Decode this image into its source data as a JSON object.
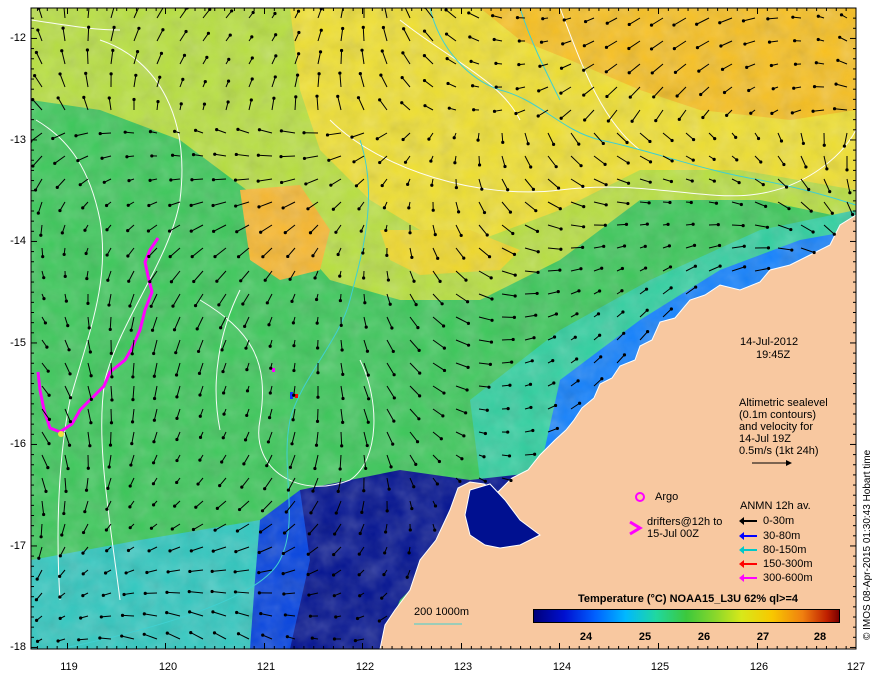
{
  "map": {
    "lat_labels": [
      "-12",
      "-13",
      "-14",
      "-15",
      "-16",
      "-17",
      "-18"
    ],
    "lon_labels": [
      "119",
      "120",
      "121",
      "122",
      "123",
      "124",
      "125",
      "126",
      "127"
    ]
  },
  "timestamp": {
    "date": "14-Jul-2012",
    "time": "19:45Z"
  },
  "altimetry_note": [
    "Altimetric sealevel",
    "(0.1m contours)",
    "and velocity for",
    "14-Jul 19Z",
    "0.5m/s (1kt 24h)"
  ],
  "argo_label": "Argo",
  "drifters_label": [
    "drifters@12h to",
    "15-Jul 00Z"
  ],
  "depth_contour_label": "200  1000m",
  "anmn": {
    "title": "ANMN 12h av.",
    "items": [
      {
        "label": "0-30m",
        "color": "#000000"
      },
      {
        "label": "30-80m",
        "color": "#0000ff"
      },
      {
        "label": "80-150m",
        "color": "#00c8c8"
      },
      {
        "label": "150-300m",
        "color": "#ff0000"
      },
      {
        "label": "300-600m",
        "color": "#ff00ff"
      }
    ]
  },
  "colorbar": {
    "title": "Temperature (°C) NOAA15_L3U 62% ql>=4",
    "ticks": [
      "24",
      "25",
      "26",
      "27",
      "28"
    ]
  },
  "credit": "© IMOS 08-Apr-2015 01:30:43 Hobart time",
  "colors": {
    "land": "#f8c8a0",
    "contour": "#ffffff",
    "isobath": "#40d0d0",
    "drifter_track": "#ff00ff"
  }
}
